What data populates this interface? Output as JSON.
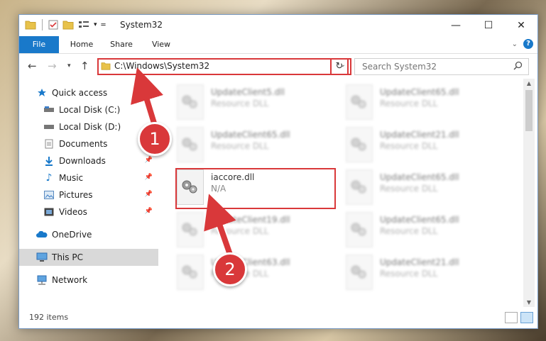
{
  "window": {
    "title": "System32",
    "controls": {
      "minimize": "—",
      "maximize": "☐",
      "close": "✕"
    }
  },
  "ribbon": {
    "tabs": [
      "File",
      "Home",
      "Share",
      "View"
    ],
    "expand_icon": "chevron-down-icon",
    "help_label": "?"
  },
  "nav": {
    "address": "C:\\Windows\\System32",
    "search_placeholder": "Search System32"
  },
  "sidebar": {
    "items": [
      {
        "label": "Quick access",
        "icon": "star-icon"
      },
      {
        "label": "Local Disk (C:)",
        "icon": "drive-icon",
        "pinned": true
      },
      {
        "label": "Local Disk (D:)",
        "icon": "drive-icon",
        "pinned": false
      },
      {
        "label": "Documents",
        "icon": "documents-icon",
        "pinned": true
      },
      {
        "label": "Downloads",
        "icon": "downloads-icon",
        "pinned": true
      },
      {
        "label": "Music",
        "icon": "music-icon",
        "pinned": true
      },
      {
        "label": "Pictures",
        "icon": "pictures-icon",
        "pinned": true
      },
      {
        "label": "Videos",
        "icon": "videos-icon",
        "pinned": true
      },
      {
        "label": "OneDrive",
        "icon": "cloud-icon"
      },
      {
        "label": "This PC",
        "icon": "computer-icon",
        "selected": true
      },
      {
        "label": "Network",
        "icon": "network-icon"
      }
    ]
  },
  "files": [
    {
      "name": "UpdateClient5.dll",
      "type": "Resource DLL"
    },
    {
      "name": "UpdateClient65.dll",
      "type": "Resource DLL"
    },
    {
      "name": "UpdateClient65.dll",
      "type": "Resource DLL"
    },
    {
      "name": "UpdateClient21.dll",
      "type": "Resource DLL"
    },
    {
      "name": "iaccore.dll",
      "type": "N/A"
    },
    {
      "name": "UpdateClient65.dll",
      "type": "Resource DLL"
    },
    {
      "name": "UpdateClient19.dll",
      "type": "Resource DLL"
    },
    {
      "name": "UpdateClient65.dll",
      "type": "Resource DLL"
    },
    {
      "name": "UpdateClient63.dll",
      "type": "Resource DLL"
    },
    {
      "name": "UpdateClient21.dll",
      "type": "Resource DLL"
    }
  ],
  "status": {
    "item_count": "192 items"
  },
  "annotations": {
    "step1": "1",
    "step2": "2"
  },
  "colors": {
    "accent": "#1979ca",
    "annotation_red": "#d9383a"
  }
}
